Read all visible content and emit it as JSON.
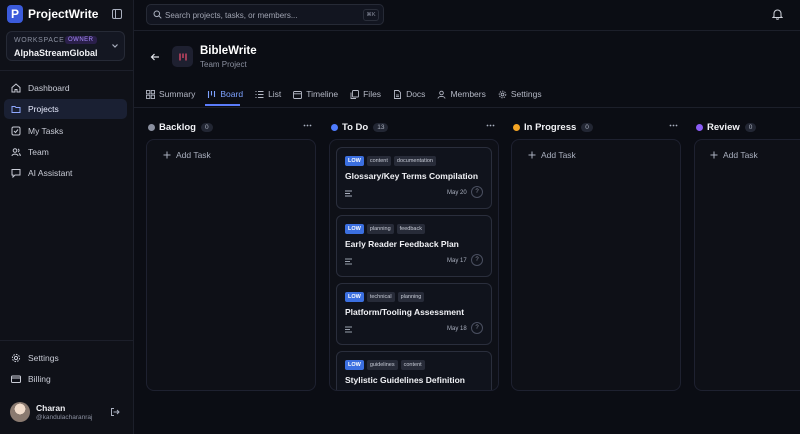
{
  "app": {
    "logo_letter": "P",
    "name": "ProjectWrite"
  },
  "workspace": {
    "label": "WORKSPACE",
    "role": "OWNER",
    "name": "AlphaStreamGlobal"
  },
  "sidebar": {
    "items": [
      {
        "label": "Dashboard",
        "icon": "home-icon"
      },
      {
        "label": "Projects",
        "icon": "folder-icon",
        "active": true
      },
      {
        "label": "My Tasks",
        "icon": "checkbox-icon"
      },
      {
        "label": "Team",
        "icon": "users-icon"
      },
      {
        "label": "AI Assistant",
        "icon": "chat-icon"
      }
    ],
    "bottom": [
      {
        "label": "Settings",
        "icon": "gear-icon"
      },
      {
        "label": "Billing",
        "icon": "card-icon"
      }
    ]
  },
  "user": {
    "name": "Charan",
    "handle": "@kandulacharanraj"
  },
  "search": {
    "placeholder": "Search projects, tasks, or members...",
    "shortcut": "⌘K"
  },
  "project": {
    "title": "BibleWrite",
    "subtitle": "Team Project"
  },
  "tabs": [
    {
      "label": "Summary",
      "icon": "grid-icon"
    },
    {
      "label": "Board",
      "icon": "kanban-icon",
      "active": true
    },
    {
      "label": "List",
      "icon": "list-icon"
    },
    {
      "label": "Timeline",
      "icon": "calendar-icon"
    },
    {
      "label": "Files",
      "icon": "files-icon"
    },
    {
      "label": "Docs",
      "icon": "doc-icon"
    },
    {
      "label": "Members",
      "icon": "members-icon"
    },
    {
      "label": "Settings",
      "icon": "gear-icon"
    }
  ],
  "board": {
    "add_task_label": "Add Task",
    "columns": [
      {
        "name": "Backlog",
        "count": "0",
        "color": "#8b90a0"
      },
      {
        "name": "To Do",
        "count": "13",
        "color": "#4f7cff"
      },
      {
        "name": "In Progress",
        "count": "0",
        "color": "#f5a524"
      },
      {
        "name": "Review",
        "count": "0",
        "color": "#8b5cf6"
      }
    ],
    "todo_cards": [
      {
        "priority": "LOW",
        "tags": [
          "content",
          "documentation"
        ],
        "title": "Glossary/Key Terms Compilation",
        "date": "May 20",
        "assignee": "?"
      },
      {
        "priority": "LOW",
        "tags": [
          "planning",
          "feedback"
        ],
        "title": "Early Reader Feedback Plan",
        "date": "May 17",
        "assignee": "?"
      },
      {
        "priority": "LOW",
        "tags": [
          "technical",
          "planning"
        ],
        "title": "Platform/Tooling Assessment",
        "date": "May 18",
        "assignee": "?"
      },
      {
        "priority": "LOW",
        "tags": [
          "guidelines",
          "content"
        ],
        "title": "Stylistic Guidelines Definition",
        "date": "",
        "assignee": ""
      }
    ]
  },
  "colors": {
    "accent": "#5b7cfa",
    "priority_low": "#3b6fe0",
    "background": "#0b0d14"
  }
}
